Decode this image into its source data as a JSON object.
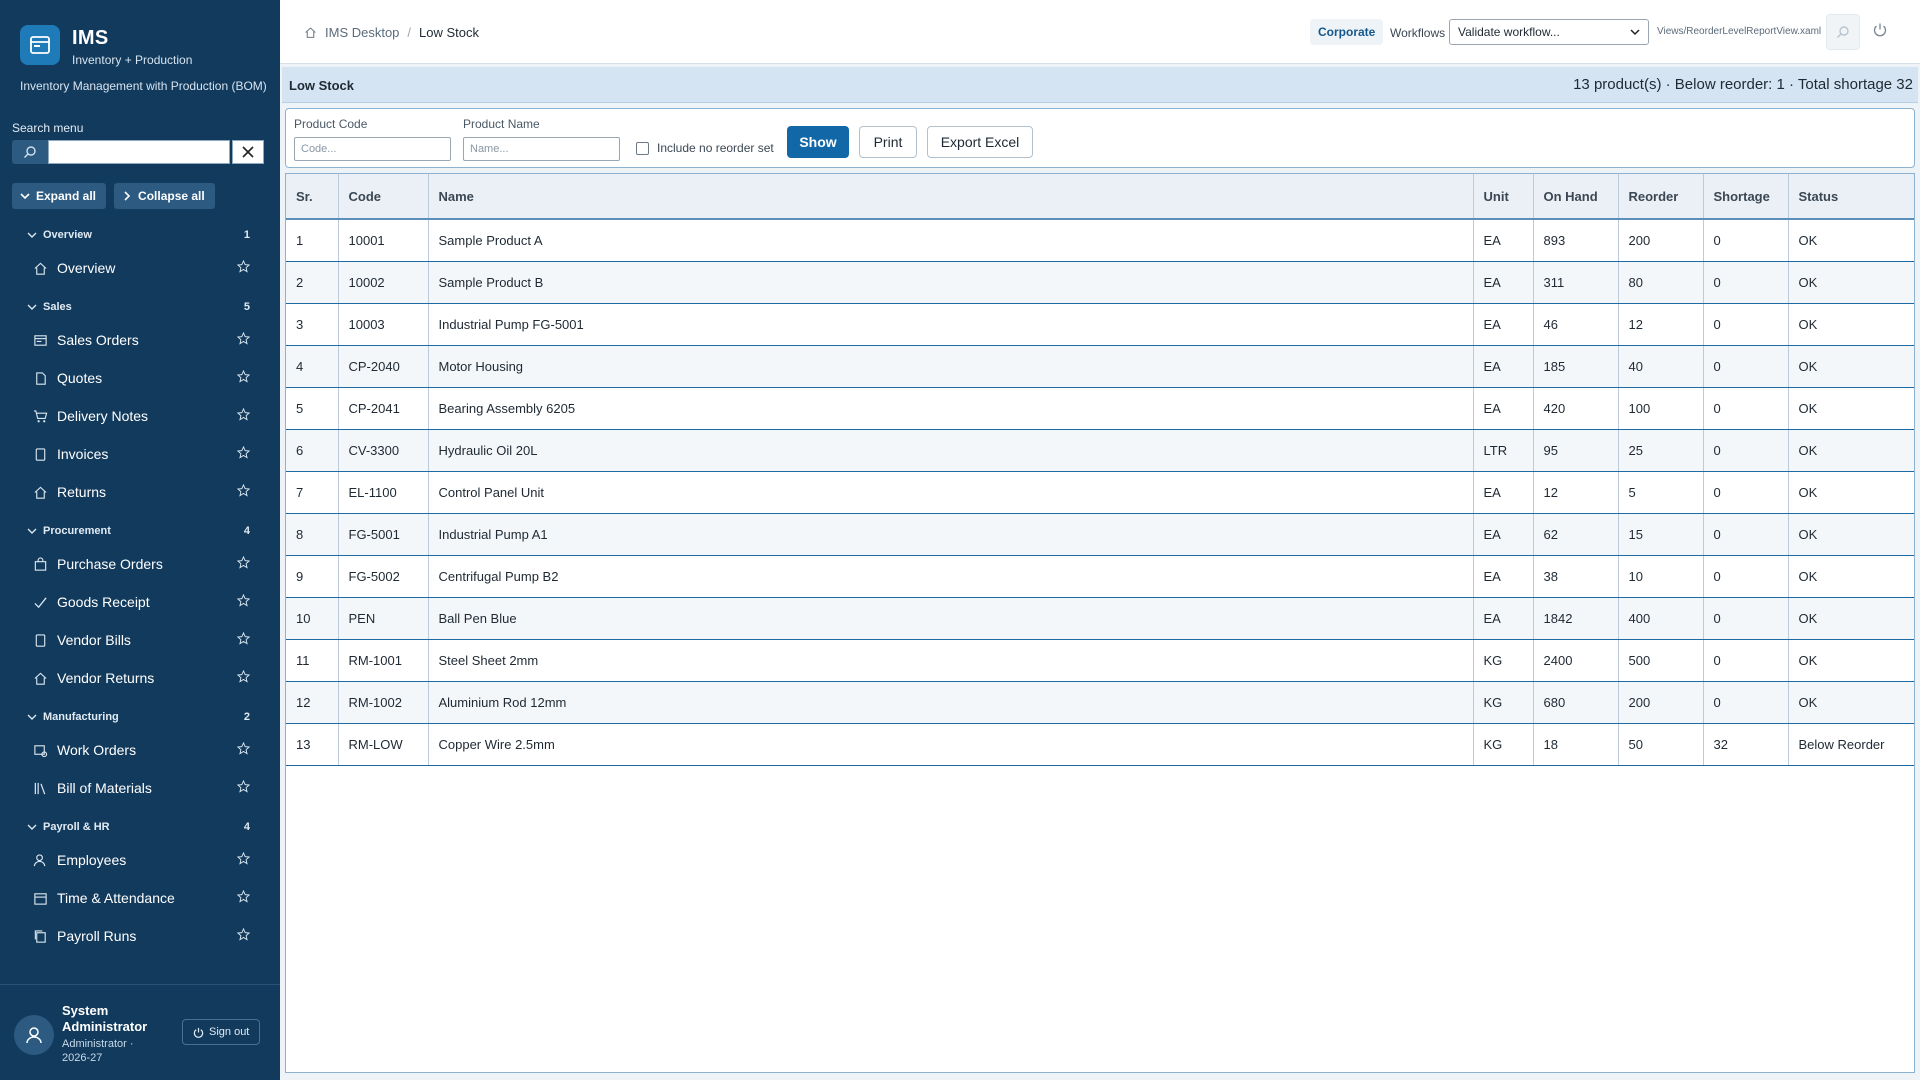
{
  "brand": {
    "title": "IMS",
    "subtitle": "Inventory + Production",
    "description": "Inventory Management with Production (BOM)"
  },
  "sidebar": {
    "search_label": "Search menu",
    "search_value": "",
    "expand_all": "Expand all",
    "collapse_all": "Collapse all",
    "groups": [
      {
        "label": "Overview",
        "count": "1",
        "items": [
          {
            "label": "Overview",
            "icon": "home-icon"
          }
        ]
      },
      {
        "label": "Sales",
        "count": "5",
        "items": [
          {
            "label": "Sales Orders",
            "icon": "sales-orders-icon"
          },
          {
            "label": "Quotes",
            "icon": "document-icon"
          },
          {
            "label": "Delivery Notes",
            "icon": "cart-icon"
          },
          {
            "label": "Invoices",
            "icon": "invoice-icon"
          },
          {
            "label": "Returns",
            "icon": "home-icon"
          }
        ]
      },
      {
        "label": "Procurement",
        "count": "4",
        "items": [
          {
            "label": "Purchase Orders",
            "icon": "bag-icon"
          },
          {
            "label": "Goods Receipt",
            "icon": "check-icon"
          },
          {
            "label": "Vendor Bills",
            "icon": "invoice-icon"
          },
          {
            "label": "Vendor Returns",
            "icon": "home-icon"
          }
        ]
      },
      {
        "label": "Manufacturing",
        "count": "2",
        "items": [
          {
            "label": "Work Orders",
            "icon": "work-orders-icon"
          },
          {
            "label": "Bill of Materials",
            "icon": "library-icon"
          }
        ]
      },
      {
        "label": "Payroll & HR",
        "count": "4",
        "items": [
          {
            "label": "Employees",
            "icon": "people-icon"
          },
          {
            "label": "Time & Attendance",
            "icon": "calendar-icon"
          },
          {
            "label": "Payroll Runs",
            "icon": "copy-icon"
          }
        ]
      }
    ]
  },
  "user": {
    "name": "System Administrator",
    "role": "Administrator · 2026-27",
    "sign_out": "Sign out"
  },
  "topbar": {
    "breadcrumb_home": "IMS Desktop",
    "breadcrumb_sep": "/",
    "breadcrumb_current": "Low Stock",
    "company": "Corporate",
    "workflows_label": "Workflows",
    "workflow_selected": "Validate workflow...",
    "view_path": "Views/ReorderLevelReportView.xaml"
  },
  "report": {
    "title": "Low Stock",
    "summary": "13 product(s) · Below reorder: 1 · Total shortage 32"
  },
  "filters": {
    "code_label": "Product Code",
    "code_placeholder": "Code...",
    "name_label": "Product Name",
    "name_placeholder": "Name...",
    "include_label": "Include no reorder set",
    "show_button": "Show",
    "print_button": "Print",
    "export_button": "Export Excel"
  },
  "table": {
    "columns": [
      "Sr.",
      "Code",
      "Name",
      "Unit",
      "On Hand",
      "Reorder",
      "Shortage",
      "Status"
    ],
    "rows": [
      [
        "1",
        "10001",
        "Sample Product A",
        "EA",
        "893",
        "200",
        "0",
        "OK"
      ],
      [
        "2",
        "10002",
        "Sample Product B",
        "EA",
        "311",
        "80",
        "0",
        "OK"
      ],
      [
        "3",
        "10003",
        "Industrial Pump FG-5001",
        "EA",
        "46",
        "12",
        "0",
        "OK"
      ],
      [
        "4",
        "CP-2040",
        "Motor Housing",
        "EA",
        "185",
        "40",
        "0",
        "OK"
      ],
      [
        "5",
        "CP-2041",
        "Bearing Assembly 6205",
        "EA",
        "420",
        "100",
        "0",
        "OK"
      ],
      [
        "6",
        "CV-3300",
        "Hydraulic Oil 20L",
        "LTR",
        "95",
        "25",
        "0",
        "OK"
      ],
      [
        "7",
        "EL-1100",
        "Control Panel Unit",
        "EA",
        "12",
        "5",
        "0",
        "OK"
      ],
      [
        "8",
        "FG-5001",
        "Industrial Pump A1",
        "EA",
        "62",
        "15",
        "0",
        "OK"
      ],
      [
        "9",
        "FG-5002",
        "Centrifugal Pump B2",
        "EA",
        "38",
        "10",
        "0",
        "OK"
      ],
      [
        "10",
        "PEN",
        "Ball Pen Blue",
        "EA",
        "1842",
        "400",
        "0",
        "OK"
      ],
      [
        "11",
        "RM-1001",
        "Steel Sheet 2mm",
        "KG",
        "2400",
        "500",
        "0",
        "OK"
      ],
      [
        "12",
        "RM-1002",
        "Aluminium Rod 12mm",
        "KG",
        "680",
        "200",
        "0",
        "OK"
      ],
      [
        "13",
        "RM-LOW",
        "Copper Wire 2.5mm",
        "KG",
        "18",
        "50",
        "32",
        "Below Reorder"
      ]
    ]
  },
  "colors": {
    "sidebar": "#123a5c",
    "accent": "#1268a7",
    "report_bar": "#d4e4f2"
  }
}
